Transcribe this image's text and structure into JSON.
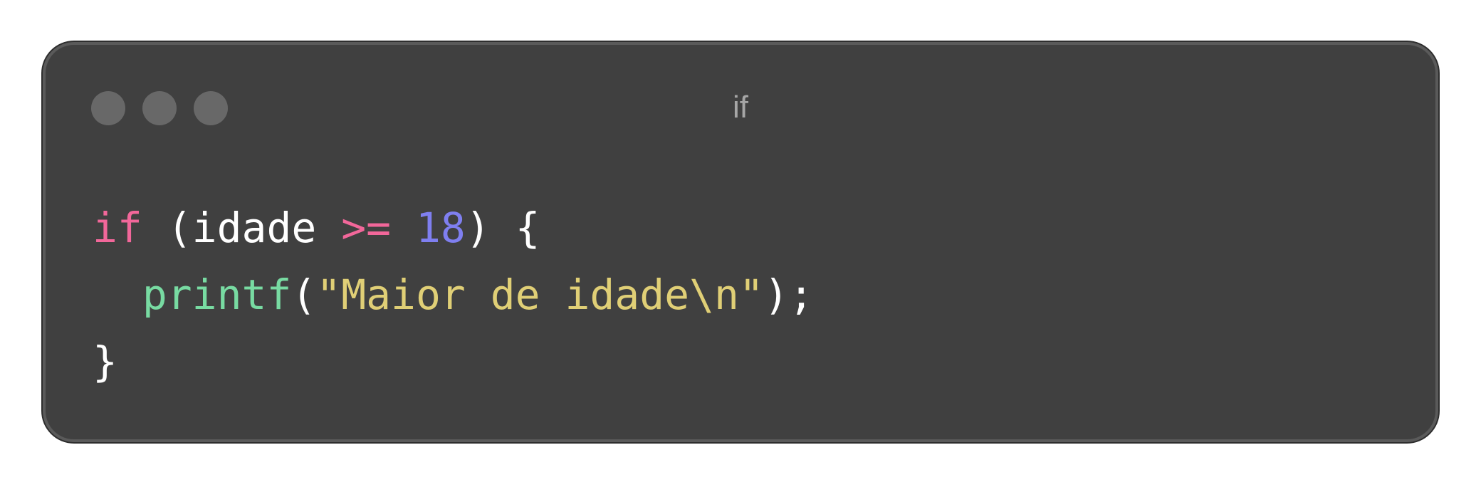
{
  "window": {
    "title": "if",
    "controls": [
      "close-dot",
      "minimize-dot",
      "maximize-dot"
    ]
  },
  "code": {
    "language": "c",
    "colors": {
      "background": "#404040",
      "keyword": "#f2679a",
      "operator": "#f2679a",
      "number": "#7f7ff0",
      "function": "#78dba2",
      "string": "#e0cf76",
      "text": "#ffffff"
    },
    "lines": [
      {
        "tokens": [
          {
            "type": "kw",
            "text": "if"
          },
          {
            "type": "plain",
            "text": " (idade "
          },
          {
            "type": "op",
            "text": ">="
          },
          {
            "type": "plain",
            "text": " "
          },
          {
            "type": "num",
            "text": "18"
          },
          {
            "type": "plain",
            "text": ") {"
          }
        ]
      },
      {
        "tokens": [
          {
            "type": "plain",
            "text": "  "
          },
          {
            "type": "fn",
            "text": "printf"
          },
          {
            "type": "plain",
            "text": "("
          },
          {
            "type": "str",
            "text": "\"Maior de idade\\n\""
          },
          {
            "type": "plain",
            "text": ");"
          }
        ]
      },
      {
        "tokens": [
          {
            "type": "plain",
            "text": "}"
          }
        ]
      }
    ]
  }
}
